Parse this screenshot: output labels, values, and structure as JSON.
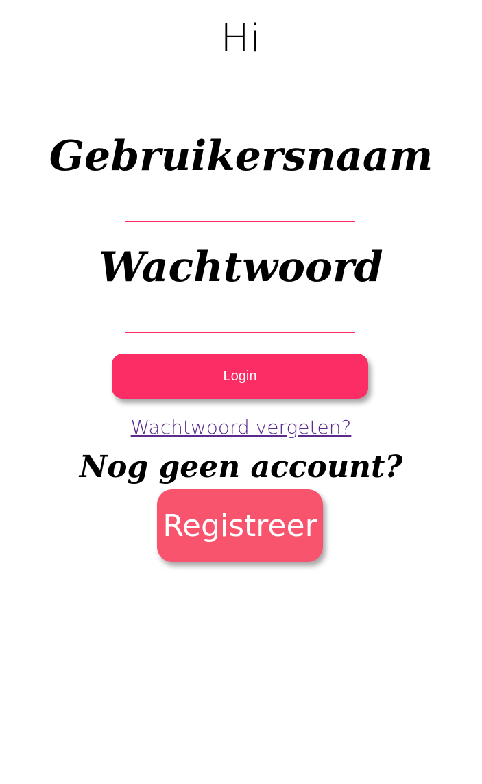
{
  "header": {
    "greeting": "Hi"
  },
  "login_form": {
    "username_label": "Gebruikersnaam",
    "username_value": "",
    "password_label": "Wachtwoord",
    "password_value": "",
    "login_label": "Login",
    "forgot_password_label": "Wachtwoord vergeten?"
  },
  "register_section": {
    "prompt": "Nog geen account?",
    "register_label": "Registreer"
  },
  "colors": {
    "accent": "#fc2d65",
    "register_button": "#f8546e",
    "link": "#5a2a8c",
    "background": "#ffffff"
  }
}
